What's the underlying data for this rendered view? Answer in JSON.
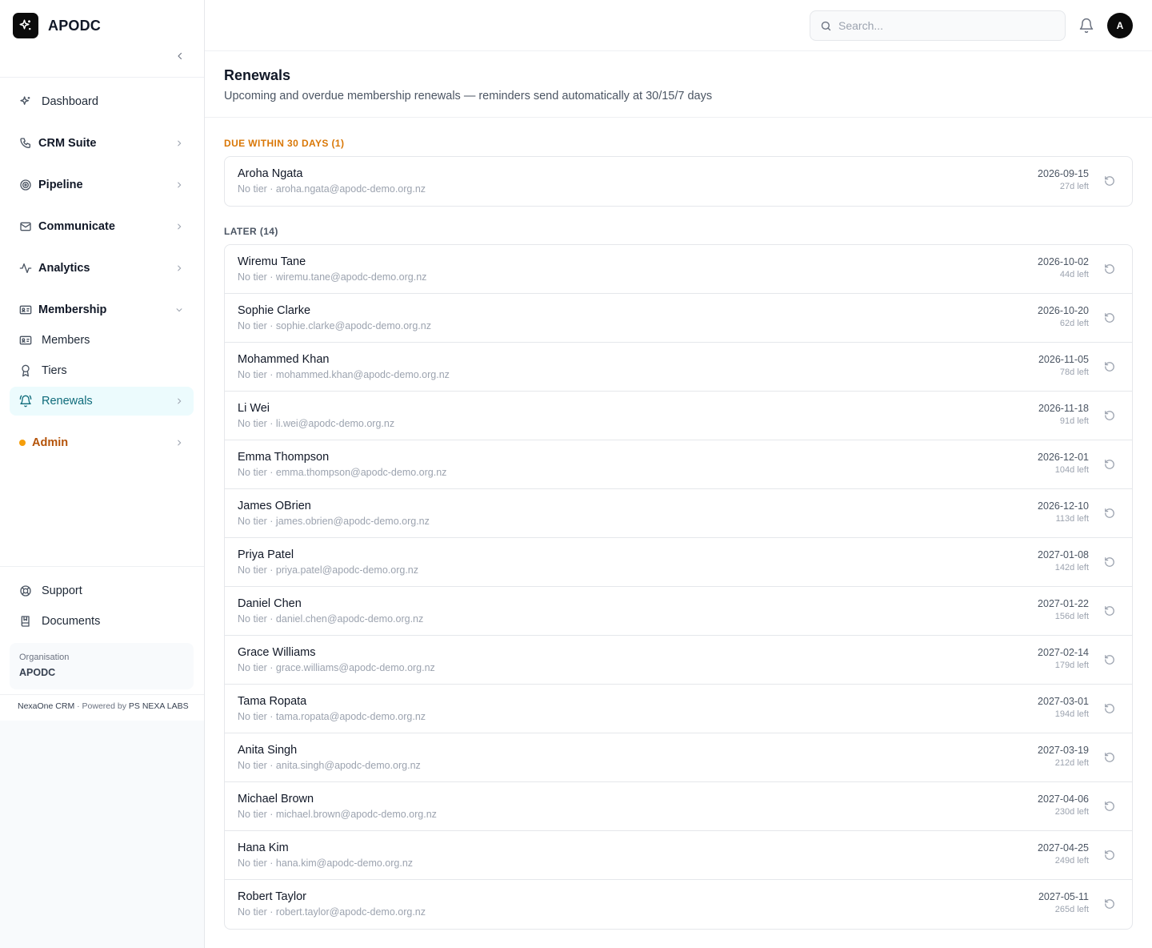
{
  "app": {
    "name": "APODC"
  },
  "sidebar": {
    "items": [
      {
        "label": "Dashboard",
        "icon": "sparkles-icon"
      },
      {
        "label": "CRM Suite",
        "icon": "phone-icon"
      },
      {
        "label": "Pipeline",
        "icon": "target-icon"
      },
      {
        "label": "Communicate",
        "icon": "mail-icon"
      },
      {
        "label": "Analytics",
        "icon": "activity-icon"
      },
      {
        "label": "Membership",
        "icon": "id-card-icon"
      },
      {
        "label": "Members",
        "icon": "id-card-icon"
      },
      {
        "label": "Tiers",
        "icon": "award-icon"
      },
      {
        "label": "Renewals",
        "icon": "bell-ring-icon"
      },
      {
        "label": "Admin",
        "icon": "dot-icon"
      }
    ],
    "bottom": [
      {
        "label": "Support",
        "icon": "life-buoy-icon"
      },
      {
        "label": "Documents",
        "icon": "book-icon"
      }
    ],
    "org": {
      "label": "Organisation",
      "name": "APODC"
    },
    "footer": {
      "product": "NexaOne CRM",
      "sep": " · Powered by ",
      "vendor": "PS NEXA LABS"
    }
  },
  "topbar": {
    "search_placeholder": "Search...",
    "avatar_initial": "A"
  },
  "page": {
    "title": "Renewals",
    "subtitle": "Upcoming and overdue membership renewals — reminders send automatically at 30/15/7 days"
  },
  "sections": {
    "due": {
      "label": "DUE WITHIN 30 DAYS (1)",
      "rows": [
        {
          "name": "Aroha Ngata",
          "meta": "No tier · aroha.ngata@apodc-demo.org.nz",
          "date": "2026-09-15",
          "left": "27d left"
        }
      ]
    },
    "later": {
      "label": "LATER (14)",
      "rows": [
        {
          "name": "Wiremu Tane",
          "meta": "No tier · wiremu.tane@apodc-demo.org.nz",
          "date": "2026-10-02",
          "left": "44d left"
        },
        {
          "name": "Sophie Clarke",
          "meta": "No tier · sophie.clarke@apodc-demo.org.nz",
          "date": "2026-10-20",
          "left": "62d left"
        },
        {
          "name": "Mohammed Khan",
          "meta": "No tier · mohammed.khan@apodc-demo.org.nz",
          "date": "2026-11-05",
          "left": "78d left"
        },
        {
          "name": "Li Wei",
          "meta": "No tier · li.wei@apodc-demo.org.nz",
          "date": "2026-11-18",
          "left": "91d left"
        },
        {
          "name": "Emma Thompson",
          "meta": "No tier · emma.thompson@apodc-demo.org.nz",
          "date": "2026-12-01",
          "left": "104d left"
        },
        {
          "name": "James OBrien",
          "meta": "No tier · james.obrien@apodc-demo.org.nz",
          "date": "2026-12-10",
          "left": "113d left"
        },
        {
          "name": "Priya Patel",
          "meta": "No tier · priya.patel@apodc-demo.org.nz",
          "date": "2027-01-08",
          "left": "142d left"
        },
        {
          "name": "Daniel Chen",
          "meta": "No tier · daniel.chen@apodc-demo.org.nz",
          "date": "2027-01-22",
          "left": "156d left"
        },
        {
          "name": "Grace Williams",
          "meta": "No tier · grace.williams@apodc-demo.org.nz",
          "date": "2027-02-14",
          "left": "179d left"
        },
        {
          "name": "Tama Ropata",
          "meta": "No tier · tama.ropata@apodc-demo.org.nz",
          "date": "2027-03-01",
          "left": "194d left"
        },
        {
          "name": "Anita Singh",
          "meta": "No tier · anita.singh@apodc-demo.org.nz",
          "date": "2027-03-19",
          "left": "212d left"
        },
        {
          "name": "Michael Brown",
          "meta": "No tier · michael.brown@apodc-demo.org.nz",
          "date": "2027-04-06",
          "left": "230d left"
        },
        {
          "name": "Hana Kim",
          "meta": "No tier · hana.kim@apodc-demo.org.nz",
          "date": "2027-04-25",
          "left": "249d left"
        },
        {
          "name": "Robert Taylor",
          "meta": "No tier · robert.taylor@apodc-demo.org.nz",
          "date": "2027-05-11",
          "left": "265d left"
        }
      ]
    }
  },
  "colors": {
    "accent": "#0e6b7a",
    "accent_bg": "#ecfbfd",
    "warning": "#d97706",
    "admin": "#b45309"
  }
}
